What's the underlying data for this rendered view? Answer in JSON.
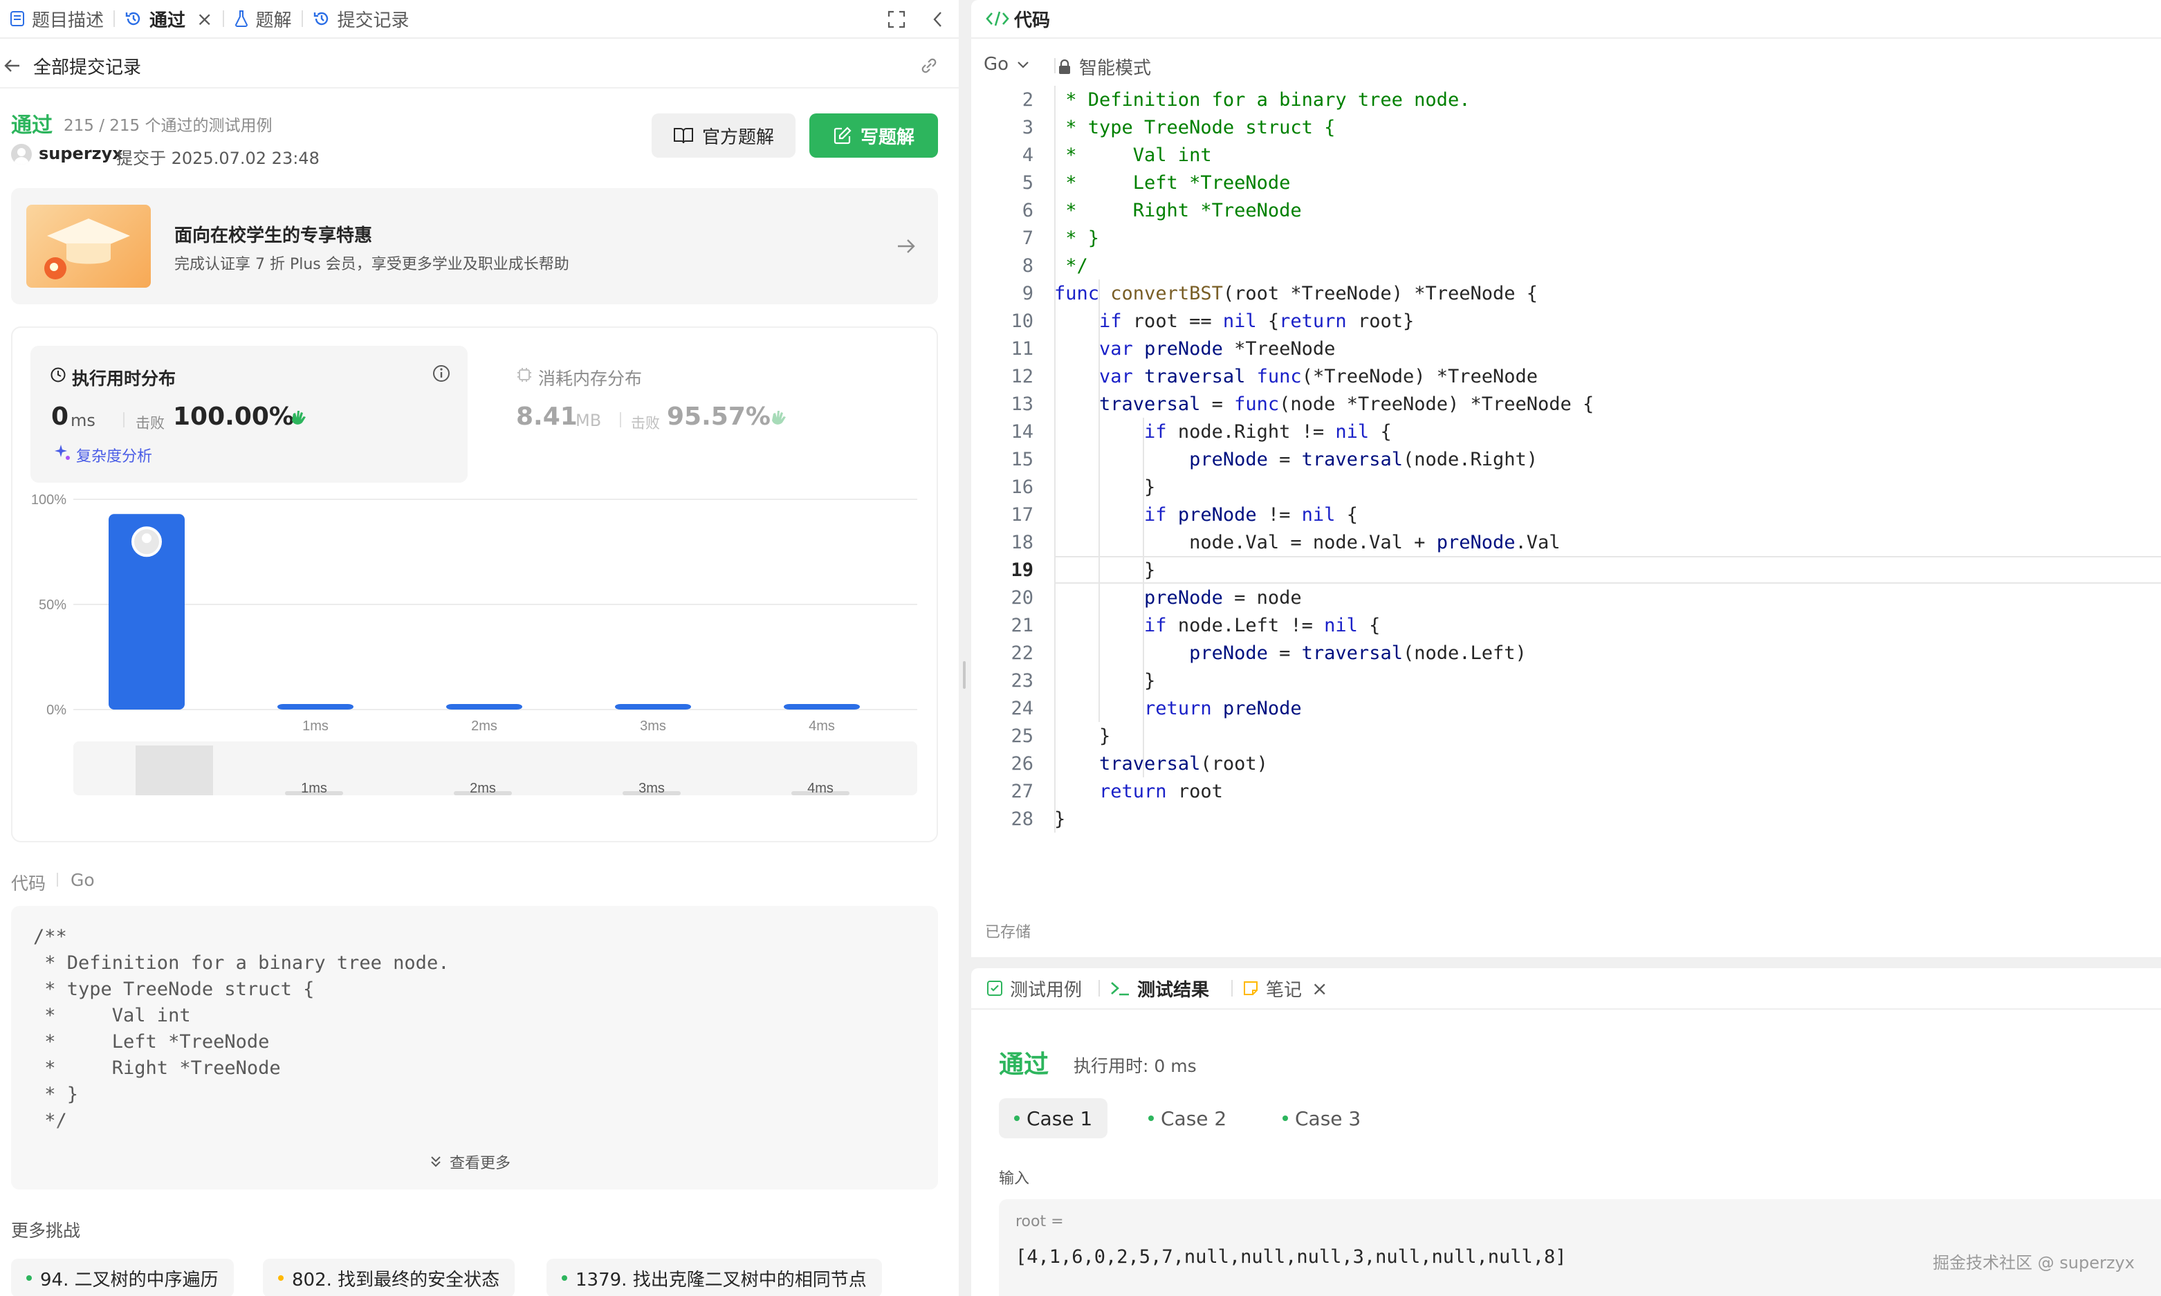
{
  "left_panel": {
    "tabs": [
      {
        "label": "题目描述",
        "icon": "description-icon"
      },
      {
        "label": "通过",
        "icon": "history-icon"
      },
      {
        "label": "题解",
        "icon": "flask-icon"
      },
      {
        "label": "提交记录",
        "icon": "history-icon"
      }
    ],
    "back_label": "全部提交记录",
    "status": "通过",
    "tests_passed": "215 / 215 个通过的测试用例",
    "user": "superzyx",
    "submitted_at": "提交于 2025.07.02 23:48",
    "official_solution_label": "官方题解",
    "write_solution_label": "写题解",
    "promo": {
      "title": "面向在校学生的专享特惠",
      "subtitle": "完成认证享 7 折 Plus 会员，享受更多学业及职业成长帮助"
    },
    "runtime": {
      "title": "执行用时分布",
      "value": "0",
      "unit": "ms",
      "beats_label": "击败",
      "beats": "100.00%",
      "analysis_label": "复杂度分析"
    },
    "memory": {
      "title": "消耗内存分布",
      "value": "8.41",
      "unit": "MB",
      "beats_label": "击败",
      "beats": "95.57%"
    },
    "code_header": {
      "label": "代码",
      "lang": "Go"
    },
    "code_preview": [
      "/**",
      " * Definition for a binary tree node.",
      " * type TreeNode struct {",
      " *     Val int",
      " *     Left *TreeNode",
      " *     Right *TreeNode",
      " * }",
      " */"
    ],
    "view_more_label": "查看更多",
    "more_challenges_label": "更多挑战",
    "challenges": [
      {
        "label": "94. 二叉树的中序遍历",
        "color": "#2db55d"
      },
      {
        "label": "802. 找到最终的安全状态",
        "color": "#ffb800"
      },
      {
        "label": "1379. 找出克隆二叉树中的相同节点",
        "color": "#2db55d"
      }
    ]
  },
  "chart_data": {
    "type": "bar",
    "title": "执行用时分布",
    "categories": [
      "0ms",
      "1ms",
      "2ms",
      "3ms",
      "4ms"
    ],
    "x_tick_labels": [
      "",
      "1ms",
      "2ms",
      "3ms",
      "4ms"
    ],
    "values": [
      93,
      1,
      1,
      1,
      1
    ],
    "y_tick_labels": [
      "100%",
      "50%",
      "0%"
    ],
    "ylim": [
      0,
      100
    ],
    "grid": true,
    "highlight_category": "0ms"
  },
  "code_panel": {
    "title": "代码",
    "lang": "Go",
    "mode": "智能模式",
    "saved_label": "已存储",
    "current_line": 19,
    "lines": [
      {
        "n": 2,
        "text": " * Definition for a binary tree node."
      },
      {
        "n": 3,
        "text": " * type TreeNode struct {"
      },
      {
        "n": 4,
        "text": " *     Val int"
      },
      {
        "n": 5,
        "text": " *     Left *TreeNode"
      },
      {
        "n": 6,
        "text": " *     Right *TreeNode"
      },
      {
        "n": 7,
        "text": " * }"
      },
      {
        "n": 8,
        "text": " */"
      },
      {
        "n": 9,
        "text": "func convertBST(root *TreeNode) *TreeNode {"
      },
      {
        "n": 10,
        "text": "    if root == nil {return root}"
      },
      {
        "n": 11,
        "text": "    var preNode *TreeNode"
      },
      {
        "n": 12,
        "text": "    var traversal func(*TreeNode) *TreeNode"
      },
      {
        "n": 13,
        "text": "    traversal = func(node *TreeNode) *TreeNode {"
      },
      {
        "n": 14,
        "text": "        if node.Right != nil {"
      },
      {
        "n": 15,
        "text": "            preNode = traversal(node.Right)"
      },
      {
        "n": 16,
        "text": "        }"
      },
      {
        "n": 17,
        "text": "        if preNode != nil {"
      },
      {
        "n": 18,
        "text": "            node.Val = node.Val + preNode.Val"
      },
      {
        "n": 19,
        "text": "        }"
      },
      {
        "n": 20,
        "text": "        preNode = node"
      },
      {
        "n": 21,
        "text": "        if node.Left != nil {"
      },
      {
        "n": 22,
        "text": "            preNode = traversal(node.Left)"
      },
      {
        "n": 23,
        "text": "        }"
      },
      {
        "n": 24,
        "text": "        return preNode"
      },
      {
        "n": 25,
        "text": "    }"
      },
      {
        "n": 26,
        "text": "    traversal(root)"
      },
      {
        "n": 27,
        "text": "    return root"
      },
      {
        "n": 28,
        "text": "}"
      }
    ]
  },
  "bottom_panel": {
    "tabs": [
      {
        "label": "测试用例",
        "icon": "checkbox-icon"
      },
      {
        "label": "测试结果",
        "icon": "terminal-icon"
      },
      {
        "label": "笔记",
        "icon": "note-icon"
      }
    ],
    "status": "通过",
    "runtime": "执行用时: 0 ms",
    "cases": [
      "Case 1",
      "Case 2",
      "Case 3"
    ],
    "input_label": "输入",
    "var_label": "root =",
    "var_value": "[4,1,6,0,2,5,7,null,null,null,3,null,null,null,8]",
    "watermark": "掘金技术社区 @ superzyx"
  }
}
